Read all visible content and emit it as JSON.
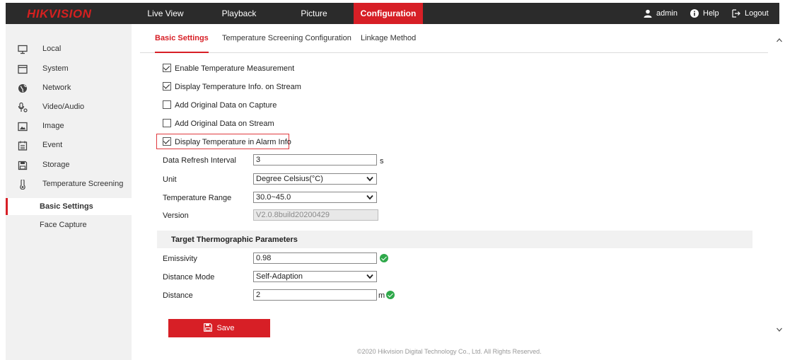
{
  "brand": {
    "logo_text": "HIKVISION",
    "accent_color": "#d71f26",
    "topbar_color": "#2b2b2b"
  },
  "topnav": [
    {
      "label": "Live View"
    },
    {
      "label": "Playback"
    },
    {
      "label": "Picture"
    },
    {
      "label": "Configuration",
      "active": true
    }
  ],
  "user_menu": {
    "user": "admin",
    "help": "Help",
    "logout": "Logout"
  },
  "sidebar": {
    "items": [
      {
        "label": "Local",
        "icon": "monitor-icon"
      },
      {
        "label": "System",
        "icon": "system-icon"
      },
      {
        "label": "Network",
        "icon": "globe-icon"
      },
      {
        "label": "Video/Audio",
        "icon": "microphone-icon"
      },
      {
        "label": "Image",
        "icon": "image-icon"
      },
      {
        "label": "Event",
        "icon": "calendar-icon"
      },
      {
        "label": "Storage",
        "icon": "storage-icon"
      },
      {
        "label": "Temperature Screening",
        "icon": "thermometer-icon"
      }
    ],
    "subitems": [
      {
        "label": "Basic Settings",
        "active": true
      },
      {
        "label": "Face Capture"
      }
    ]
  },
  "tabs": [
    {
      "label": "Basic Settings",
      "active": true
    },
    {
      "label": "Temperature Screening Configuration"
    },
    {
      "label": "Linkage Method"
    }
  ],
  "checkboxes": [
    {
      "label": "Enable Temperature Measurement",
      "checked": true
    },
    {
      "label": "Display Temperature Info. on Stream",
      "checked": true
    },
    {
      "label": "Add Original Data on Capture",
      "checked": false
    },
    {
      "label": "Add Original Data on Stream",
      "checked": false
    },
    {
      "label": "Display Temperature in Alarm Info",
      "checked": true,
      "highlighted": true
    }
  ],
  "fields": {
    "refresh": {
      "label": "Data Refresh Interval",
      "value": "3",
      "unit": "s"
    },
    "unit": {
      "label": "Unit",
      "value": "Degree Celsius(°C)"
    },
    "range": {
      "label": "Temperature Range",
      "value": "30.0~45.0"
    },
    "version": {
      "label": "Version",
      "value": "V2.0.8build20200429"
    }
  },
  "thermographic": {
    "title": "Target Thermographic Parameters",
    "emissivity": {
      "label": "Emissivity",
      "value": "0.98"
    },
    "distance_mode": {
      "label": "Distance Mode",
      "value": "Self-Adaption"
    },
    "distance": {
      "label": "Distance",
      "value": "2",
      "unit": "m"
    }
  },
  "save_label": "Save",
  "footer": "©2020 Hikvision Digital Technology Co., Ltd. All Rights Reserved."
}
